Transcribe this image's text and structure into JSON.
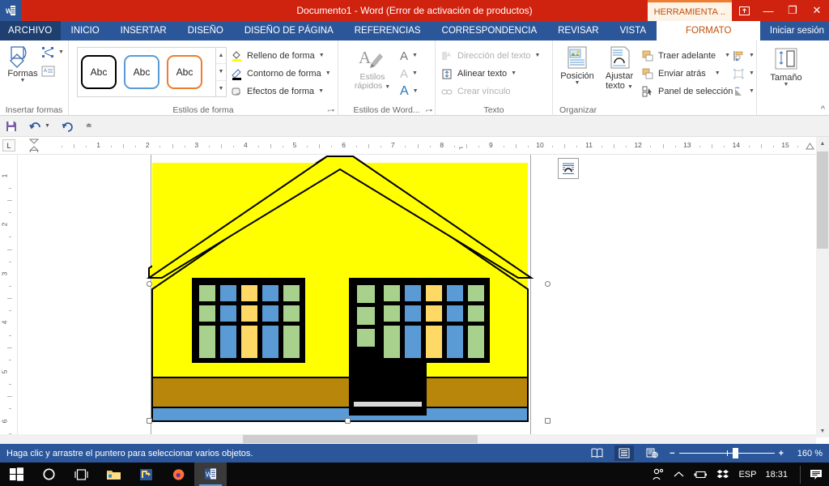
{
  "titlebar": {
    "app_icon": "word-icon",
    "title": "Documento1 -  Word (Error de activación de productos)",
    "contextual_tab_title": "HERRAMIENTA...",
    "help_label": "?",
    "ribbon_display_label": "ribbon-display-options-icon",
    "minimize_label": "—",
    "restore_label": "❐",
    "close_label": "✕"
  },
  "tabs": {
    "archivo": "ARCHIVO",
    "items": [
      "INICIO",
      "INSERTAR",
      "DISEÑO",
      "DISEÑO DE PÁGINA",
      "REFERENCIAS",
      "CORRESPONDENCIA",
      "REVISAR",
      "VISTA"
    ],
    "contextual": "FORMATO",
    "signin": "Iniciar sesión"
  },
  "ribbon": {
    "groups": [
      {
        "id": "insertar-formas",
        "label": "Insertar formas"
      },
      {
        "id": "estilos-de-forma",
        "label": "Estilos de forma"
      },
      {
        "id": "estilos-de-wordart",
        "label": "Estilos de Word..."
      },
      {
        "id": "texto",
        "label": "Texto"
      },
      {
        "id": "organizar",
        "label": "Organizar"
      },
      {
        "id": "tamano",
        "label": ""
      }
    ],
    "shapes": {
      "label": "Formas"
    },
    "shape_gallery": {
      "thumb_label": "Abc",
      "thumbs": [
        "Abc",
        "Abc",
        "Abc"
      ]
    },
    "shape_fill": "Relleno de forma",
    "shape_outline": "Contorno de forma",
    "shape_effects": "Efectos de forma",
    "quick_styles": "Estilos\nrápidos",
    "quick_styles_l1": "Estilos",
    "quick_styles_l2": "rápidos",
    "wordart_a_fill": "A",
    "wordart_a_outline": "A",
    "wordart_a_effects": "A",
    "text_direction": "Dirección del texto",
    "align_text": "Alinear texto",
    "create_link": "Crear vínculo",
    "position_l1": "Posición",
    "wrap_l1": "Ajustar",
    "wrap_l2": "texto",
    "bring_forward": "Traer adelante",
    "send_backward": "Enviar atrás",
    "selection_pane": "Panel de selección",
    "size_label": "Tamaño",
    "collapse_ribbon": "^"
  },
  "qat": {
    "save": "save-icon",
    "undo": "undo-icon",
    "redo": "redo-icon",
    "customize": "customize-icon"
  },
  "rulers": {
    "corner_tab": "L",
    "horizontal_numbers": [
      "1",
      "2",
      "3",
      "4",
      "5",
      "6",
      "7",
      "8",
      "9",
      "10",
      "11",
      "12",
      "13",
      "14",
      "15"
    ],
    "vertical_numbers": [
      "1",
      "2",
      "3",
      "4",
      "5",
      "6"
    ]
  },
  "document": {
    "drawing_name": "house-drawing",
    "layout_options_icon": "layout-options-icon",
    "colors": {
      "roof": "#FFFF00",
      "wall": "#FFFF00",
      "foundation": "#B8860B",
      "base": "#5B9BD5",
      "frame": "#000000",
      "pane_green": "#A9D18E",
      "pane_blue": "#5B9BD5",
      "pane_yellow": "#FFD966",
      "outline": "#000000"
    },
    "windows": {
      "left": {
        "cols": 5,
        "rows": 4,
        "pane_colors": [
          "green",
          "blue",
          "yellow",
          "blue",
          "green"
        ]
      },
      "right": {
        "cols": 5,
        "rows": 4,
        "pane_colors": [
          "green",
          "blue",
          "yellow",
          "blue",
          "green"
        ]
      },
      "door": {
        "cols": 3,
        "rows": 3,
        "pane_colors": [
          "green",
          "blue",
          "yellow"
        ]
      }
    }
  },
  "statusbar": {
    "message": "Haga clic y arrastre el puntero para seleccionar varios objetos.",
    "view_read": "read-mode-icon",
    "view_print": "print-layout-icon",
    "view_web": "web-layout-icon",
    "zoom_out": "−",
    "zoom_in": "+",
    "zoom_level": "160 %"
  },
  "taskbar": {
    "start": "windows-start-icon",
    "search": "cortana-search-icon",
    "taskview": "task-view-icon",
    "explorer": "file-explorer-icon",
    "app4": "app-icon",
    "firefox": "firefox-icon",
    "word": "word-taskbar-icon",
    "tray": {
      "people": "people-icon",
      "chevron": "show-hidden-icons-icon",
      "battery": "battery-icon",
      "dropbox": "dropbox-icon",
      "language": "ESP",
      "clock": "18:31",
      "notifications": "notifications-icon"
    }
  }
}
